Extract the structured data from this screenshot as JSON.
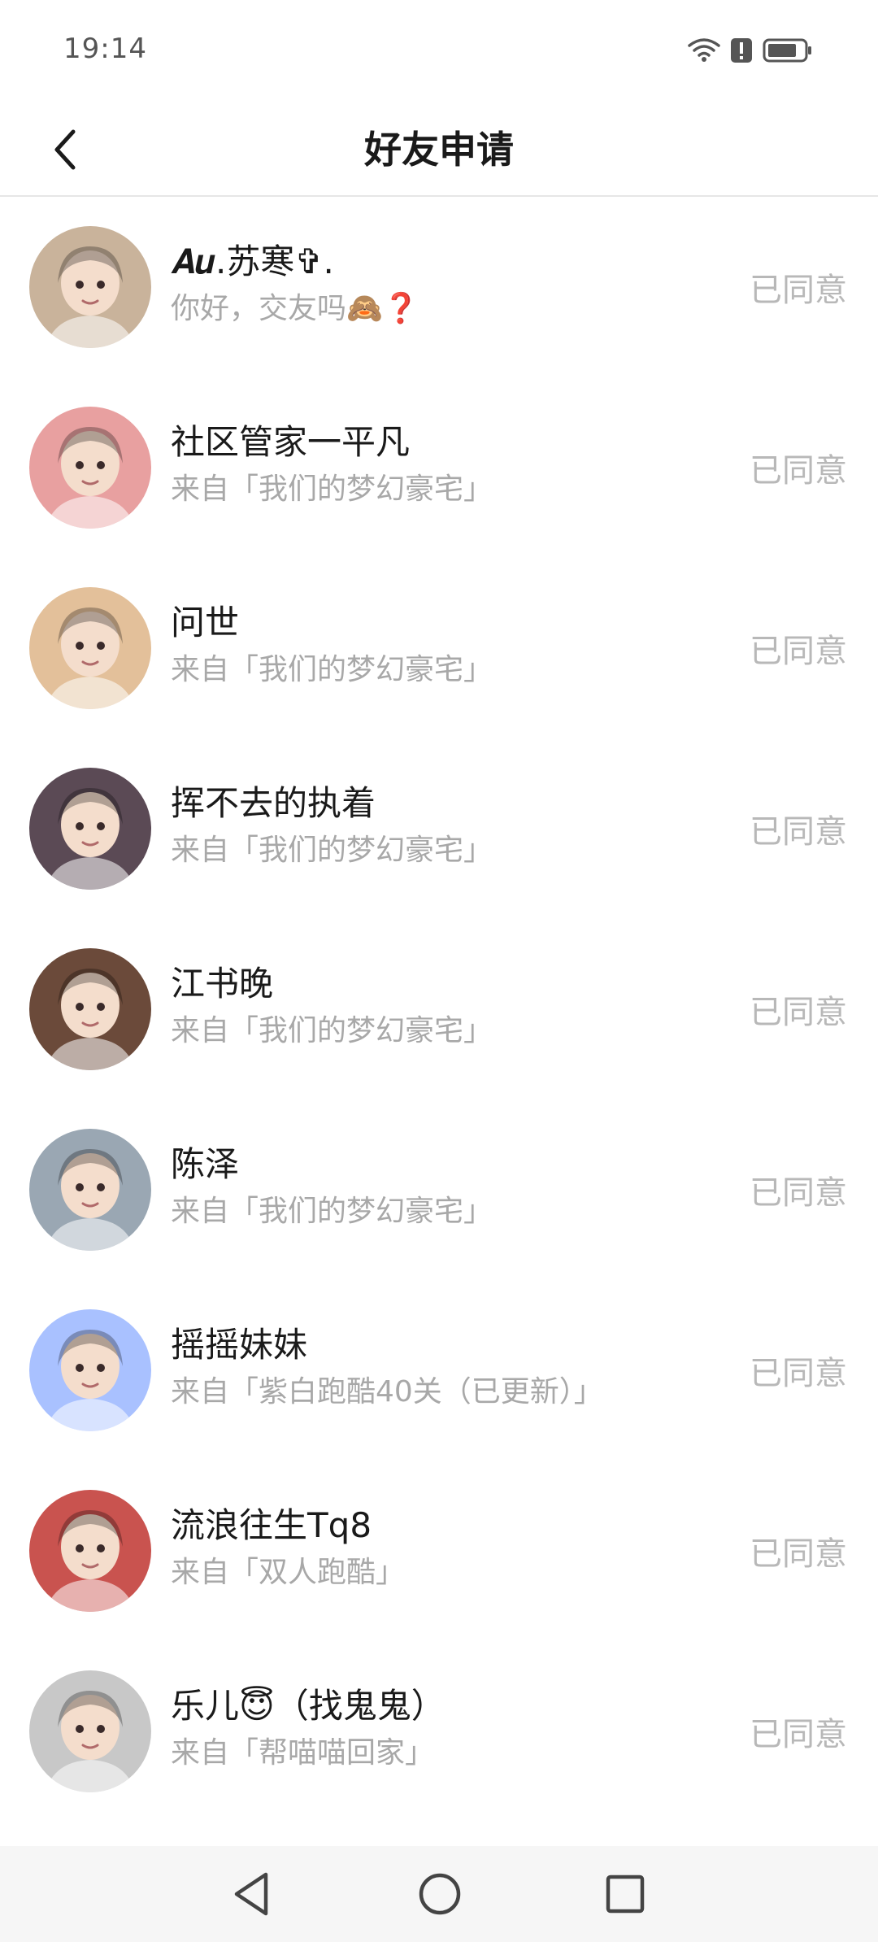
{
  "status_bar": {
    "time": "19:14"
  },
  "header": {
    "title": "好友申请"
  },
  "requests": [
    {
      "name": "𝑨𝒖.苏寒✞.",
      "sub": "你好，交友吗🙈❓",
      "status": "已同意",
      "avatar_color": "#c9b39b"
    },
    {
      "name": "社区管家一平凡",
      "sub": "来自「我们的梦幻豪宅」",
      "status": "已同意",
      "avatar_color": "#e8a0a0"
    },
    {
      "name": "问世",
      "sub": "来自「我们的梦幻豪宅」",
      "status": "已同意",
      "avatar_color": "#e3c09a"
    },
    {
      "name": "挥不去的执着",
      "sub": "来自「我们的梦幻豪宅」",
      "status": "已同意",
      "avatar_color": "#5b4a55"
    },
    {
      "name": "江书晚",
      "sub": "来自「我们的梦幻豪宅」",
      "status": "已同意",
      "avatar_color": "#6b4a3a"
    },
    {
      "name": "陈泽",
      "sub": "来自「我们的梦幻豪宅」",
      "status": "已同意",
      "avatar_color": "#9aa7b3"
    },
    {
      "name": "摇摇妹妹",
      "sub": "来自「紫白跑酷40关（已更新）」",
      "status": "已同意",
      "avatar_color": "#a9c1ff"
    },
    {
      "name": "流浪往生Tq8",
      "sub": "来自「双人跑酷」",
      "status": "已同意",
      "avatar_color": "#c9534f"
    },
    {
      "name": "乐儿😇（找鬼鬼）",
      "sub": "来自「帮喵喵回家」",
      "status": "已同意",
      "avatar_color": "#c8c8c8"
    }
  ]
}
